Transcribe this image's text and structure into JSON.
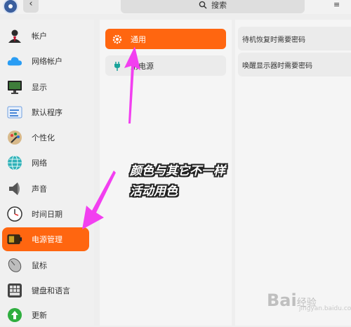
{
  "topbar": {
    "back_icon": "‹",
    "search_label": "搜索",
    "menu_icon": "≡"
  },
  "sidebar": {
    "items": [
      {
        "label": "帐户",
        "icon": "account-icon"
      },
      {
        "label": "网络帐户",
        "icon": "cloud-icon"
      },
      {
        "label": "显示",
        "icon": "display-icon"
      },
      {
        "label": "默认程序",
        "icon": "default-apps-icon"
      },
      {
        "label": "个性化",
        "icon": "personalization-icon"
      },
      {
        "label": "网络",
        "icon": "network-icon"
      },
      {
        "label": "声音",
        "icon": "sound-icon"
      },
      {
        "label": "时间日期",
        "icon": "clock-icon"
      },
      {
        "label": "电源管理",
        "icon": "battery-icon",
        "active": true
      },
      {
        "label": "鼠标",
        "icon": "mouse-icon"
      },
      {
        "label": "键盘和语言",
        "icon": "keyboard-icon"
      },
      {
        "label": "更新",
        "icon": "update-icon"
      }
    ]
  },
  "middle": {
    "items": [
      {
        "label": "通用",
        "icon": "gear-icon",
        "active": true
      },
      {
        "label": "用电源",
        "icon": "plug-icon"
      }
    ]
  },
  "settings": {
    "rows": [
      {
        "label": "待机恢复时需要密码"
      },
      {
        "label": "唤醒显示器时需要密码"
      }
    ]
  },
  "annotation": {
    "line1": "颜色与其它不一样",
    "line2": "活动用色"
  },
  "watermark": {
    "prefix": "Bai",
    "suffix": "经验",
    "domain": "jingyan.baidu.com"
  },
  "colors": {
    "accent": "#ff6610",
    "arrow": "#f23ff0"
  }
}
